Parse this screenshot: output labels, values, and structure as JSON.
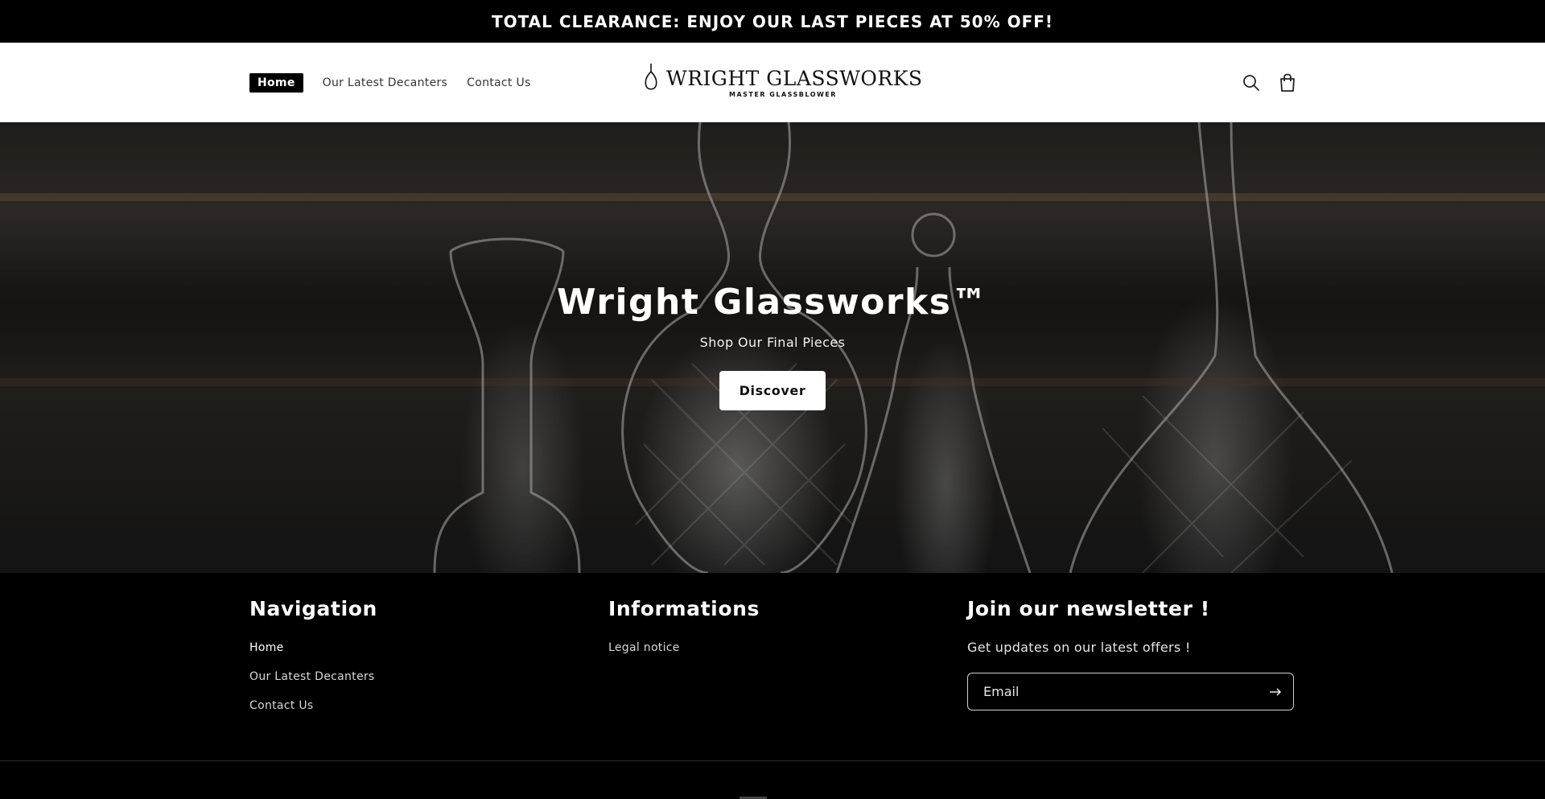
{
  "announcement": {
    "text": "TOTAL CLEARANCE: ENJOY OUR LAST PIECES AT 50% OFF!"
  },
  "header": {
    "nav": [
      {
        "label": "Home",
        "active": true
      },
      {
        "label": "Our Latest Decanters",
        "active": false
      },
      {
        "label": "Contact Us",
        "active": false
      }
    ],
    "logo": {
      "brand": "WRIGHT GLASSWORKS",
      "tagline": "MASTER GLASSBLOWER"
    },
    "icons": {
      "search": "search-icon",
      "cart": "cart-icon"
    }
  },
  "hero": {
    "title": "Wright Glassworks™",
    "subtitle": "Shop Our Final Pieces",
    "button": "Discover"
  },
  "footer": {
    "navigation": {
      "heading": "Navigation",
      "links": [
        "Home",
        "Our Latest Decanters",
        "Contact Us"
      ]
    },
    "informations": {
      "heading": "Informations",
      "links": [
        "Legal notice"
      ]
    },
    "newsletter": {
      "heading": "Join our newsletter !",
      "text": "Get updates on our latest offers !",
      "placeholder": "Email",
      "submit_icon": "arrow-right-icon"
    }
  },
  "colors": {
    "accent": "#000000",
    "background": "#ffffff",
    "footer": "#000000"
  }
}
